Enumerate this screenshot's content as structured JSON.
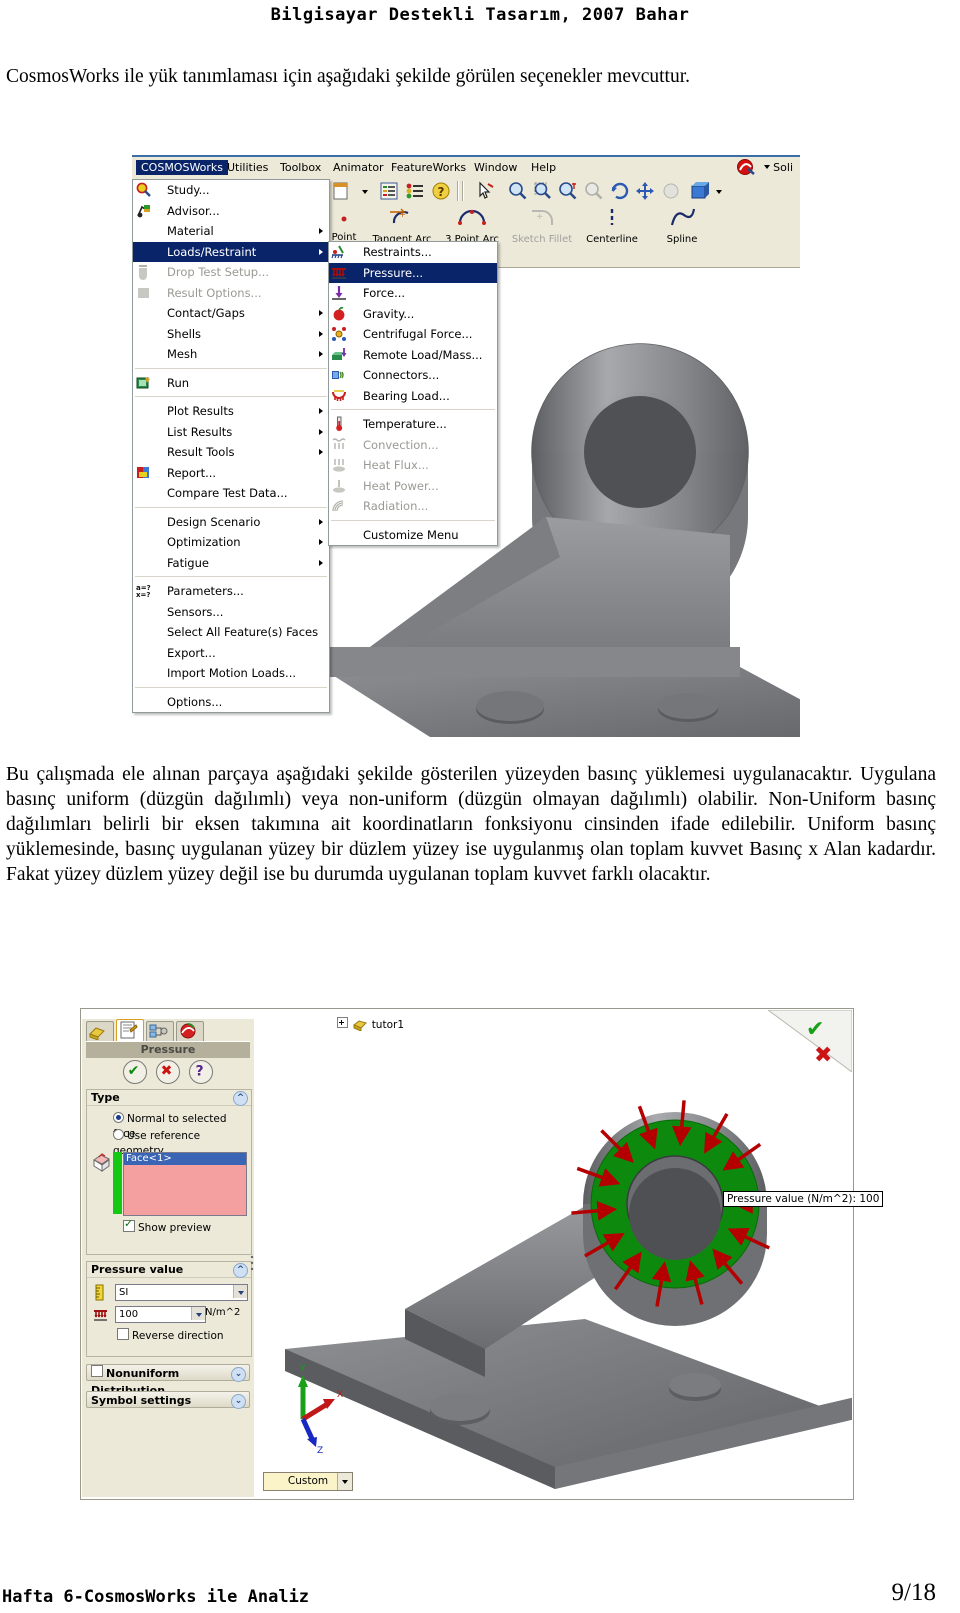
{
  "document": {
    "header": "Bilgisayar Destekli Tasarım, 2007 Bahar",
    "footer_left": "Hafta 6-CosmosWorks ile Analiz",
    "footer_page": "9/18",
    "paragraph1": "CosmosWorks ile yük tanımlaması için aşağıdaki şekilde görülen seçenekler mevcuttur.",
    "paragraph2": "Bu çalışmada ele alınan parçaya aşağıdaki şekilde gösterilen yüzeyden basınç yüklemesi uygulanacaktır. Uygulana basınç uniform (düzgün dağılımlı) veya non-uniform (düzgün olmayan dağılımlı) olabilir. Non-Uniform basınç dağılımları belirli bir eksen takımına ait koordinatların fonksiyonu cinsinden ifade edilebilir. Uniform basınç yüklemesinde, basınç uygulanan yüzey bir düzlem yüzey ise uygulanmış olan toplam kuvvet Basınç x Alan kadardır. Fakat yüzey düzlem yüzey değil ise bu durumda uygulanan toplam kuvvet farklı olacaktır."
  },
  "figure1": {
    "menubar": [
      {
        "label": "COSMOSWorks",
        "selected": true
      },
      {
        "label": "Utilities",
        "selected": false
      },
      {
        "label": "Toolbox",
        "selected": false
      },
      {
        "label": "Animator",
        "selected": false
      },
      {
        "label": "FeatureWorks",
        "selected": false
      },
      {
        "label": "Window",
        "selected": false
      },
      {
        "label": "Help",
        "selected": false
      }
    ],
    "solidworks_button_label": "Soli",
    "main_menu": [
      {
        "label": "Study...",
        "icon": "study-icon",
        "arrow": false,
        "disabled": false,
        "selected": false
      },
      {
        "label": "Advisor...",
        "icon": "advisor-icon",
        "arrow": false,
        "disabled": false,
        "selected": false
      },
      {
        "label": "Material",
        "icon": "",
        "arrow": true,
        "disabled": false,
        "selected": false
      },
      {
        "label": "Loads/Restraint",
        "icon": "",
        "arrow": true,
        "disabled": false,
        "selected": true
      },
      {
        "label": "Drop Test Setup...",
        "icon": "drop-test-icon",
        "arrow": false,
        "disabled": true,
        "selected": false
      },
      {
        "label": "Result Options...",
        "icon": "result-options-icon",
        "arrow": false,
        "disabled": true,
        "selected": false
      },
      {
        "label": "Contact/Gaps",
        "icon": "",
        "arrow": true,
        "disabled": false,
        "selected": false
      },
      {
        "label": "Shells",
        "icon": "",
        "arrow": true,
        "disabled": false,
        "selected": false
      },
      {
        "label": "Mesh",
        "icon": "",
        "arrow": true,
        "disabled": false,
        "selected": false
      },
      {
        "separator": true
      },
      {
        "label": "Run",
        "icon": "run-icon",
        "arrow": false,
        "disabled": false,
        "selected": false
      },
      {
        "separator": true
      },
      {
        "label": "Plot Results",
        "icon": "",
        "arrow": true,
        "disabled": false,
        "selected": false
      },
      {
        "label": "List Results",
        "icon": "",
        "arrow": true,
        "disabled": false,
        "selected": false
      },
      {
        "label": "Result Tools",
        "icon": "",
        "arrow": true,
        "disabled": false,
        "selected": false
      },
      {
        "label": "Report...",
        "icon": "report-icon",
        "arrow": false,
        "disabled": false,
        "selected": false
      },
      {
        "label": "Compare Test Data...",
        "icon": "",
        "arrow": false,
        "disabled": false,
        "selected": false
      },
      {
        "separator": true
      },
      {
        "label": "Design Scenario",
        "icon": "",
        "arrow": true,
        "disabled": false,
        "selected": false
      },
      {
        "label": "Optimization",
        "icon": "",
        "arrow": true,
        "disabled": false,
        "selected": false
      },
      {
        "label": "Fatigue",
        "icon": "",
        "arrow": true,
        "disabled": false,
        "selected": false
      },
      {
        "separator": true
      },
      {
        "label": "Parameters...",
        "icon": "parameters-icon",
        "arrow": false,
        "disabled": false,
        "selected": false
      },
      {
        "label": "Sensors...",
        "icon": "",
        "arrow": false,
        "disabled": false,
        "selected": false
      },
      {
        "label": "Select All Feature(s) Faces",
        "icon": "",
        "arrow": false,
        "disabled": false,
        "selected": false
      },
      {
        "label": "Export...",
        "icon": "",
        "arrow": false,
        "disabled": false,
        "selected": false
      },
      {
        "label": "Import Motion Loads...",
        "icon": "",
        "arrow": false,
        "disabled": false,
        "selected": false
      },
      {
        "separator": true
      },
      {
        "label": "Options...",
        "icon": "",
        "arrow": false,
        "disabled": false,
        "selected": false
      }
    ],
    "submenu": [
      {
        "label": "Restraints...",
        "icon": "restraints-icon",
        "disabled": false,
        "selected": false
      },
      {
        "label": "Pressure...",
        "icon": "pressure-icon",
        "disabled": false,
        "selected": true
      },
      {
        "label": "Force...",
        "icon": "force-icon",
        "disabled": false,
        "selected": false
      },
      {
        "label": "Gravity...",
        "icon": "gravity-icon",
        "disabled": false,
        "selected": false
      },
      {
        "label": "Centrifugal Force...",
        "icon": "centrifugal-force-icon",
        "disabled": false,
        "selected": false
      },
      {
        "label": "Remote Load/Mass...",
        "icon": "remote-load-icon",
        "disabled": false,
        "selected": false
      },
      {
        "label": "Connectors...",
        "icon": "connectors-icon",
        "disabled": false,
        "selected": false
      },
      {
        "label": "Bearing Load...",
        "icon": "bearing-load-icon",
        "disabled": false,
        "selected": false
      },
      {
        "separator": true
      },
      {
        "label": "Temperature...",
        "icon": "temperature-icon",
        "disabled": false,
        "selected": false
      },
      {
        "label": "Convection...",
        "icon": "convection-icon",
        "disabled": true,
        "selected": false
      },
      {
        "label": "Heat Flux...",
        "icon": "heat-flux-icon",
        "disabled": true,
        "selected": false
      },
      {
        "label": "Heat Power...",
        "icon": "heat-power-icon",
        "disabled": true,
        "selected": false
      },
      {
        "label": "Radiation...",
        "icon": "radiation-icon",
        "disabled": true,
        "selected": false
      },
      {
        "separator": true
      },
      {
        "label": "Customize Menu",
        "icon": "",
        "disabled": false,
        "selected": false
      }
    ],
    "sketch_toolbar": [
      {
        "label": "Point",
        "icon": "point-icon",
        "disabled": false
      },
      {
        "label": "Tangent Arc",
        "icon": "tangent-arc-icon",
        "disabled": false
      },
      {
        "label": "3 Point Arc",
        "icon": "three-point-arc-icon",
        "disabled": false
      },
      {
        "label": "Sketch Fillet",
        "icon": "sketch-fillet-icon",
        "disabled": true
      },
      {
        "label": "Centerline",
        "icon": "centerline-icon",
        "disabled": false
      },
      {
        "label": "Spline",
        "icon": "spline-icon",
        "disabled": false
      }
    ]
  },
  "figure2": {
    "panel_title": "Pressure",
    "tabs": [
      {
        "name": "feature-manager-tab",
        "active": false
      },
      {
        "name": "property-manager-tab",
        "active": true
      },
      {
        "name": "configuration-manager-tab",
        "active": false
      },
      {
        "name": "cosmos-manager-tab",
        "active": false
      }
    ],
    "ok_buttons": [
      {
        "name": "accept-button",
        "glyph": "✔",
        "color": "#0a8a0a"
      },
      {
        "name": "cancel-button",
        "glyph": "✖",
        "color": "#cc1414"
      },
      {
        "name": "help-button",
        "glyph": "?",
        "color": "#5a2a8a"
      }
    ],
    "type_group": {
      "title": "Type",
      "options": [
        {
          "label": "Normal to selected face",
          "selected": true
        },
        {
          "label": "Use reference geometry",
          "selected": false
        }
      ],
      "selection_value": "Face<1>",
      "show_preview_label": "Show preview",
      "show_preview_checked": true
    },
    "pressure_value_group": {
      "title": "Pressure value",
      "units_value": "SI",
      "value": "100",
      "unit_label": "N/m^2",
      "reverse_direction_label": "Reverse direction",
      "reverse_direction_checked": false
    },
    "nonuniform_label": "Nonuniform Distribution",
    "nonuniform_checked": false,
    "symbol_settings_label": "Symbol settings",
    "tree_item": "tutor1",
    "tooltip": "Pressure value (N/m^2): 100",
    "custom_combo_value": "Custom",
    "viewport_accept_glyph": "✔",
    "viewport_cancel_glyph": "✖"
  },
  "colors": {
    "menu_highlight": "#0a246a",
    "selected_face": "#f4a0a0",
    "selected_face_3d": "#0d8a0d",
    "arrow_red": "#b40000",
    "part_gray": "#808080",
    "toolbar_bg": "#ece9d8"
  }
}
